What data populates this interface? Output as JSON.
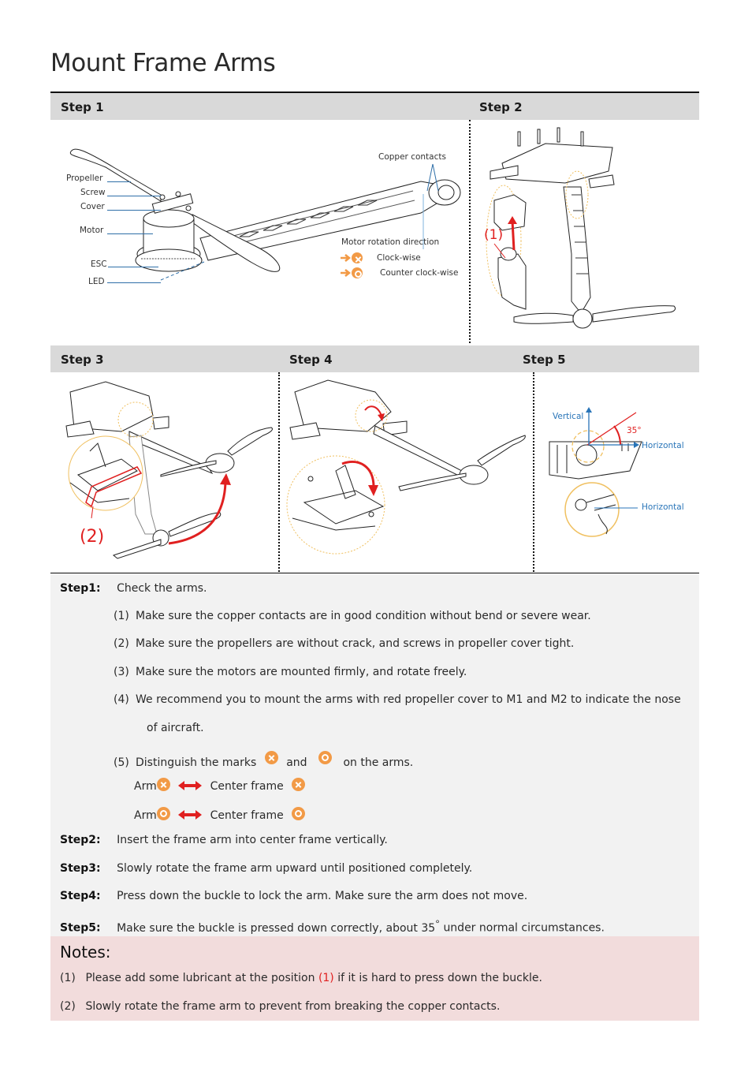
{
  "page": {
    "title": "Mount Frame Arms"
  },
  "headers": {
    "step1": "Step 1",
    "step2": "Step 2",
    "step3": "Step 3",
    "step4": "Step 4",
    "step5": "Step 5"
  },
  "step1_figure": {
    "labels": {
      "propeller": "Propeller",
      "screw": "Screw",
      "cover": "Cover",
      "motor": "Motor",
      "esc": "ESC",
      "led": "LED",
      "copper_contacts": "Copper contacts",
      "rotation_title": "Motor rotation direction",
      "clockwise": "Clock-wise",
      "counter_clockwise": "Counter clock-wise"
    }
  },
  "step2_figure": {
    "callout": "(1)"
  },
  "step3_figure": {
    "callout": "(2)"
  },
  "step5_figure": {
    "vertical": "Vertical",
    "horizontal_top": "Horizontal",
    "horizontal_bottom": "Horizontal",
    "angle": "35°"
  },
  "instructions": {
    "step1": {
      "label": "Step1:",
      "text": "Check the arms.",
      "items": [
        {
          "num": "(1)",
          "text": "Make sure the copper contacts are in good condition without bend or severe wear."
        },
        {
          "num": "(2)",
          "text": "Make sure the propellers are without crack, and screws in propeller cover tight."
        },
        {
          "num": "(3)",
          "text": "Make sure the motors are mounted firmly, and rotate freely."
        },
        {
          "num": "(4)",
          "text": "We recommend you to mount the arms with red propeller cover to M1 and M2 to indicate the nose",
          "cont": "of aircraft."
        },
        {
          "num": "(5)",
          "text_a": "Distinguish the marks",
          "text_b": "and",
          "text_c": "on the arms."
        }
      ],
      "pairs": [
        {
          "arm": "Arm",
          "frame": "Center frame",
          "mark": "clockwise-mark"
        },
        {
          "arm": "Arm",
          "frame": "Center frame",
          "mark": "counter-clockwise-mark"
        }
      ]
    },
    "step2": {
      "label": "Step2:",
      "text": "Insert the frame arm into center frame vertically."
    },
    "step3": {
      "label": "Step3:",
      "text": "Slowly rotate the frame arm upward until positioned completely."
    },
    "step4": {
      "label": "Step4:",
      "text": "Press down the buckle to lock the arm. Make sure the arm does not move."
    },
    "step5": {
      "label": "Step5:",
      "text_a": "Make sure the buckle is pressed down correctly, about 35",
      "degree": "°",
      "text_b": "under normal circumstances."
    }
  },
  "notes": {
    "title": "Notes:",
    "items": [
      {
        "num": "(1)",
        "text_a": "Please add some lubricant at the position",
        "highlight": "(1)",
        "text_b": "if it is hard to press down the buckle."
      },
      {
        "num": "(2)",
        "text": "Slowly rotate the frame arm to prevent from breaking the copper contacts."
      }
    ]
  },
  "colors": {
    "header_bg": "#d9d9d9",
    "instructions_bg": "#f2f2f2",
    "notes_bg": "#f2dcdc",
    "accent_red": "#e02020",
    "mark_orange": "#f29a46",
    "label_blue": "#2874b8"
  }
}
